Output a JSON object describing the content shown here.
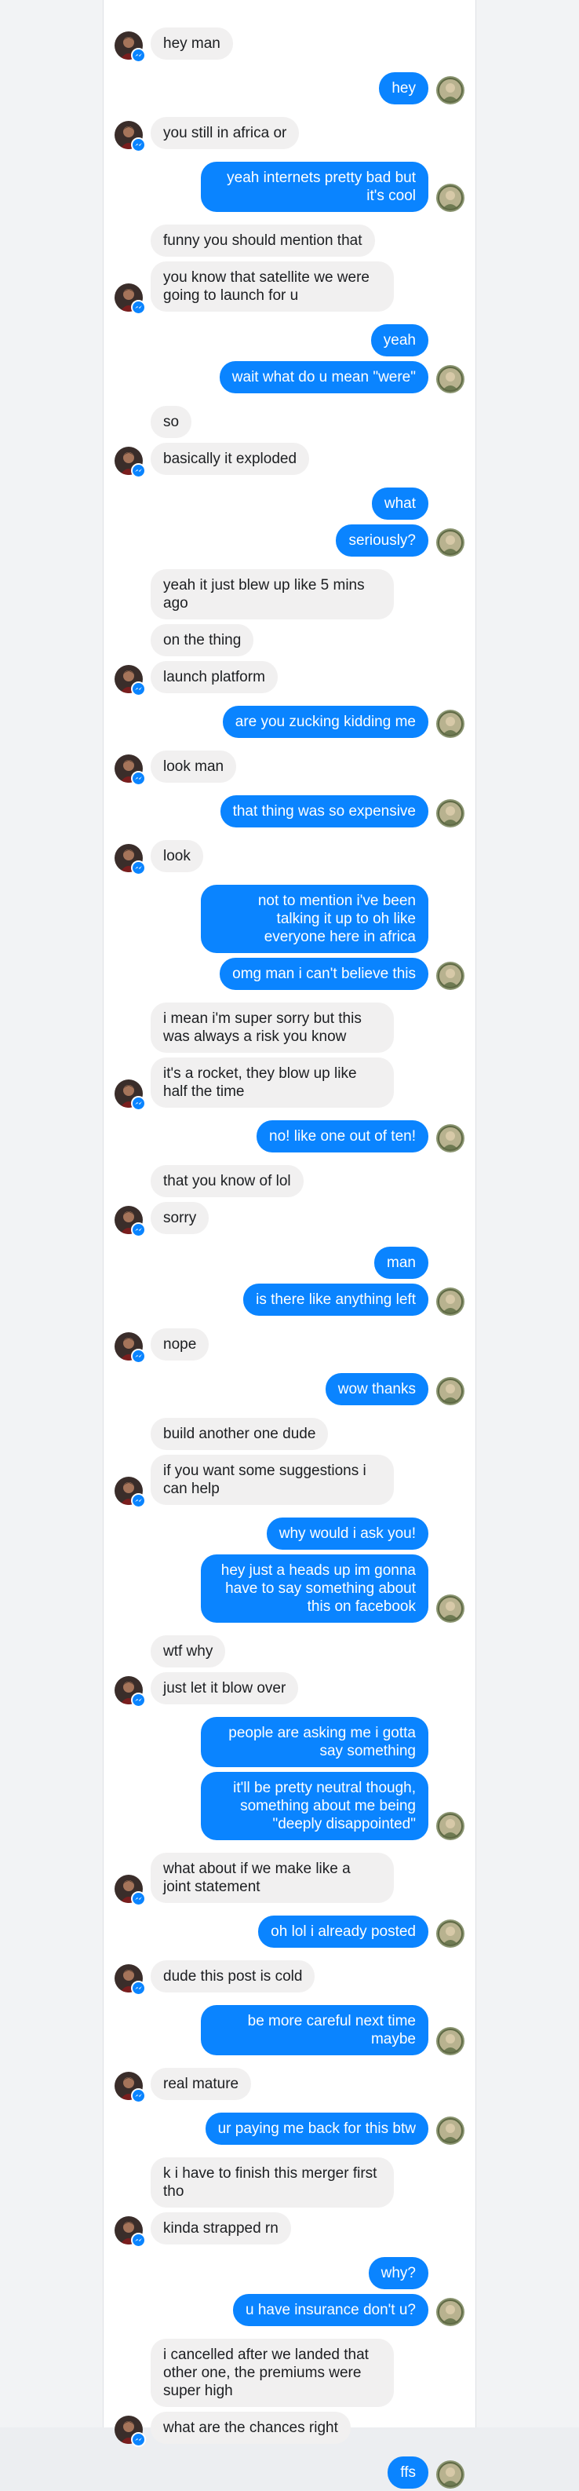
{
  "colors": {
    "sent_bubble": "#0a84ff",
    "received_bubble": "#f1f0f0",
    "background": "#ffffff"
  },
  "icons": {
    "sender_avatar": "avatar-icon",
    "badge": "messenger-badge-icon"
  },
  "conversation": [
    {
      "side": "recv",
      "messages": [
        "hey man"
      ]
    },
    {
      "side": "sent",
      "messages": [
        "hey"
      ]
    },
    {
      "side": "recv",
      "messages": [
        "you still in africa or"
      ]
    },
    {
      "side": "sent",
      "messages": [
        "yeah internets pretty bad but it's cool"
      ]
    },
    {
      "side": "recv",
      "messages": [
        "funny you should mention that",
        "you know that satellite we were going to launch for u"
      ]
    },
    {
      "side": "sent",
      "messages": [
        "yeah",
        "wait what do u mean \"were\""
      ]
    },
    {
      "side": "recv",
      "messages": [
        "so",
        "basically it exploded"
      ]
    },
    {
      "side": "sent",
      "messages": [
        "what",
        "seriously?"
      ]
    },
    {
      "side": "recv",
      "messages": [
        "yeah it just blew up like 5 mins ago",
        "on the thing",
        "launch platform"
      ]
    },
    {
      "side": "sent",
      "messages": [
        "are you zucking kidding me"
      ]
    },
    {
      "side": "recv",
      "messages": [
        "look man"
      ]
    },
    {
      "side": "sent",
      "messages": [
        "that thing was so expensive"
      ]
    },
    {
      "side": "recv",
      "messages": [
        "look"
      ]
    },
    {
      "side": "sent",
      "messages": [
        "not to mention i've been talking it up to oh like everyone here in africa",
        "omg man i can't believe this"
      ]
    },
    {
      "side": "recv",
      "messages": [
        "i mean i'm super sorry but this was always a risk you know",
        "it's a rocket, they blow up like half the time"
      ]
    },
    {
      "side": "sent",
      "messages": [
        "no! like one out of ten!"
      ]
    },
    {
      "side": "recv",
      "messages": [
        "that you know of lol",
        "sorry"
      ]
    },
    {
      "side": "sent",
      "messages": [
        "man",
        "is there like anything left"
      ]
    },
    {
      "side": "recv",
      "messages": [
        "nope"
      ]
    },
    {
      "side": "sent",
      "messages": [
        "wow thanks"
      ]
    },
    {
      "side": "recv",
      "messages": [
        "build another one dude",
        "if you want some suggestions i can help"
      ]
    },
    {
      "side": "sent",
      "messages": [
        "why would i ask you!",
        "hey just a heads up im gonna have to say something about this on facebook"
      ]
    },
    {
      "side": "recv",
      "messages": [
        "wtf why",
        "just let it blow over"
      ]
    },
    {
      "side": "sent",
      "messages": [
        "people are asking me i gotta say something",
        "it'll be pretty neutral though, something about me being \"deeply disappointed\""
      ]
    },
    {
      "side": "recv",
      "messages": [
        "what about if we make like a joint statement"
      ]
    },
    {
      "side": "sent",
      "messages": [
        "oh lol i already posted"
      ]
    },
    {
      "side": "recv",
      "messages": [
        "dude this post is cold"
      ]
    },
    {
      "side": "sent",
      "messages": [
        "be more careful next time maybe"
      ]
    },
    {
      "side": "recv",
      "messages": [
        "real mature"
      ]
    },
    {
      "side": "sent",
      "messages": [
        "ur paying me back for this btw"
      ]
    },
    {
      "side": "recv",
      "messages": [
        "k i have to finish this merger first tho",
        "kinda strapped rn"
      ]
    },
    {
      "side": "sent",
      "messages": [
        "why?",
        "u have insurance don't u?"
      ]
    },
    {
      "side": "recv",
      "messages": [
        "i cancelled after we landed that other one, the premiums were super high",
        "what are the chances right"
      ]
    },
    {
      "side": "sent",
      "messages": [
        "ffs"
      ]
    }
  ]
}
